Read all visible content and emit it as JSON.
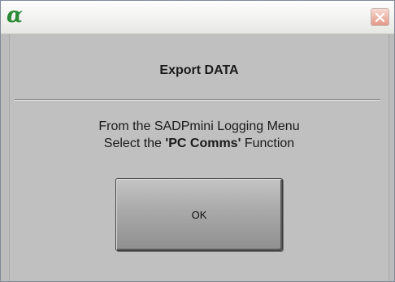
{
  "window": {
    "icon": "alpha-logo-icon",
    "icon_glyph": "α",
    "close_icon": "close-icon",
    "accent_icon_color": "#2a8a35",
    "close_button_color": "#e39a89"
  },
  "dialog": {
    "heading": "Export DATA",
    "message_line1": "From the SADPmini Logging Menu",
    "message_line2_prefix": "Select the ",
    "message_line2_emphasis": "'PC Comms'",
    "message_line2_suffix": " Function",
    "ok_label": "OK"
  }
}
